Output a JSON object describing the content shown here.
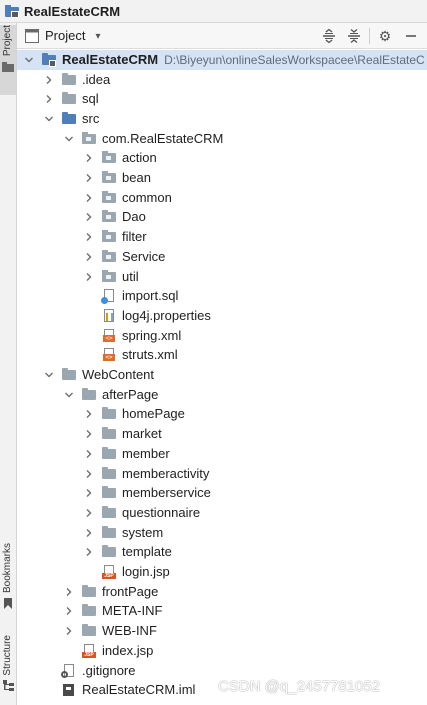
{
  "window": {
    "title": "RealEstateCRM"
  },
  "side_tabs": {
    "project": "Project",
    "bookmarks": "Bookmarks",
    "structure": "Structure"
  },
  "toolbar": {
    "view_label": "Project",
    "icons": [
      "expand-all-icon",
      "collapse-all-icon",
      "gear-icon",
      "hide-icon"
    ]
  },
  "tree": [
    {
      "label": "RealEstateCRM",
      "path": "D:\\Biyeyun\\onlineSalesWorkspacee\\RealEstateC",
      "depth": 0,
      "chevron": "down",
      "icon": "module-folder",
      "selected": true
    },
    {
      "label": ".idea",
      "depth": 1,
      "chevron": "right",
      "icon": "folder"
    },
    {
      "label": "sql",
      "depth": 1,
      "chevron": "right",
      "icon": "folder"
    },
    {
      "label": "src",
      "depth": 1,
      "chevron": "down",
      "icon": "source-folder"
    },
    {
      "label": "com.RealEstateCRM",
      "depth": 2,
      "chevron": "down",
      "icon": "package"
    },
    {
      "label": "action",
      "depth": 3,
      "chevron": "right",
      "icon": "package"
    },
    {
      "label": "bean",
      "depth": 3,
      "chevron": "right",
      "icon": "package"
    },
    {
      "label": "common",
      "depth": 3,
      "chevron": "right",
      "icon": "package"
    },
    {
      "label": "Dao",
      "depth": 3,
      "chevron": "right",
      "icon": "package"
    },
    {
      "label": "filter",
      "depth": 3,
      "chevron": "right",
      "icon": "package"
    },
    {
      "label": "Service",
      "depth": 3,
      "chevron": "right",
      "icon": "package"
    },
    {
      "label": "util",
      "depth": 3,
      "chevron": "right",
      "icon": "package"
    },
    {
      "label": "import.sql",
      "depth": 3,
      "chevron": "none",
      "icon": "sql-file"
    },
    {
      "label": "log4j.properties",
      "depth": 3,
      "chevron": "none",
      "icon": "properties-file"
    },
    {
      "label": "spring.xml",
      "depth": 3,
      "chevron": "none",
      "icon": "xml-file"
    },
    {
      "label": "struts.xml",
      "depth": 3,
      "chevron": "none",
      "icon": "xml-file"
    },
    {
      "label": "WebContent",
      "depth": 1,
      "chevron": "down",
      "icon": "folder"
    },
    {
      "label": "afterPage",
      "depth": 2,
      "chevron": "down",
      "icon": "folder"
    },
    {
      "label": "homePage",
      "depth": 3,
      "chevron": "right",
      "icon": "folder"
    },
    {
      "label": "market",
      "depth": 3,
      "chevron": "right",
      "icon": "folder"
    },
    {
      "label": "member",
      "depth": 3,
      "chevron": "right",
      "icon": "folder"
    },
    {
      "label": "memberactivity",
      "depth": 3,
      "chevron": "right",
      "icon": "folder"
    },
    {
      "label": "memberservice",
      "depth": 3,
      "chevron": "right",
      "icon": "folder"
    },
    {
      "label": "questionnaire",
      "depth": 3,
      "chevron": "right",
      "icon": "folder"
    },
    {
      "label": "system",
      "depth": 3,
      "chevron": "right",
      "icon": "folder"
    },
    {
      "label": "template",
      "depth": 3,
      "chevron": "right",
      "icon": "folder"
    },
    {
      "label": "login.jsp",
      "depth": 3,
      "chevron": "none",
      "icon": "jsp-file"
    },
    {
      "label": "frontPage",
      "depth": 2,
      "chevron": "right",
      "icon": "folder"
    },
    {
      "label": "META-INF",
      "depth": 2,
      "chevron": "right",
      "icon": "folder"
    },
    {
      "label": "WEB-INF",
      "depth": 2,
      "chevron": "right",
      "icon": "folder"
    },
    {
      "label": "index.jsp",
      "depth": 2,
      "chevron": "none",
      "icon": "jsp-file"
    },
    {
      "label": ".gitignore",
      "depth": 1,
      "chevron": "none",
      "icon": "gitignore-file"
    },
    {
      "label": "RealEstateCRM.iml",
      "depth": 1,
      "chevron": "none",
      "icon": "iml-file"
    }
  ],
  "watermark": "CSDN @q_2457781052",
  "colors": {
    "selection": "#d5e3f5",
    "folder": "#9aa7b0",
    "source_folder": "#4f7fb8",
    "xml": "#e06b2d",
    "jsp": "#d9541e"
  }
}
